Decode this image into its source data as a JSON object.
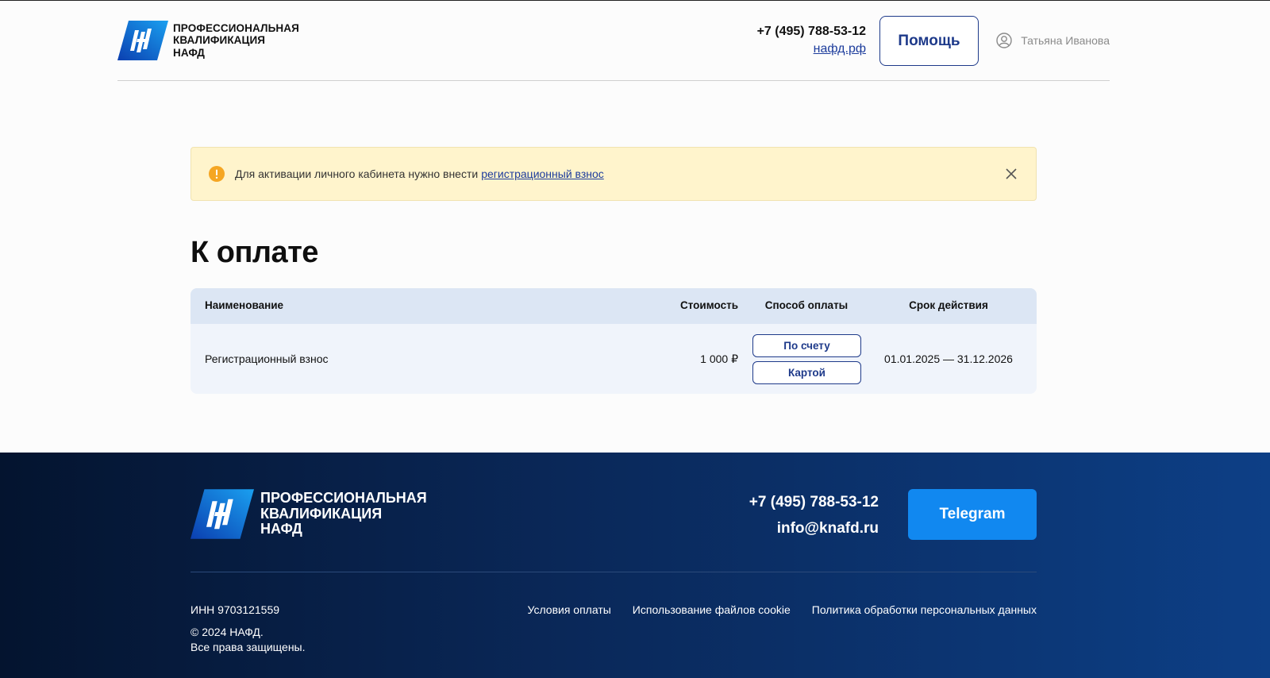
{
  "header": {
    "logo_lines": [
      "ПРОФЕССИОНАЛЬНАЯ",
      "КВАЛИФИКАЦИЯ",
      "НАФД"
    ],
    "phone": "+7 (495) 788-53-12",
    "site_link": "нафд.рф",
    "help_button": "Помощь",
    "user_name": "Татьяна Иванова"
  },
  "alert": {
    "text": "Для активации личного кабинета нужно внести",
    "link": "регистрационный взнос",
    "icon_color": "#f5a623"
  },
  "page_title": "К оплате",
  "table": {
    "columns": {
      "name": "Наименование",
      "cost": "Стоимость",
      "method": "Способ оплаты",
      "term": "Срок действия"
    },
    "rows": [
      {
        "name": "Регистрационный взнос",
        "cost": "1 000 ₽",
        "methods": [
          "По счету",
          "Картой"
        ],
        "term": "01.01.2025 — 31.12.2026"
      }
    ]
  },
  "footer": {
    "logo_lines": [
      "ПРОФЕССИОНАЛЬНАЯ",
      "КВАЛИФИКАЦИЯ",
      "НАФД"
    ],
    "phone": "+7 (495) 788-53-12",
    "email": "info@knafd.ru",
    "telegram_button": "Telegram",
    "inn": "ИНН 9703121559",
    "copyright_line1": "© 2024 НАФД.",
    "copyright_line2": "Все права защищены.",
    "links": [
      "Условия оплаты",
      "Использование файлов cookie",
      "Политика обработки персональных данных"
    ]
  },
  "colors": {
    "brand_blue": "#1e3a8a",
    "accent_blue": "#1188f0",
    "alert_bg": "#fff4cc"
  }
}
